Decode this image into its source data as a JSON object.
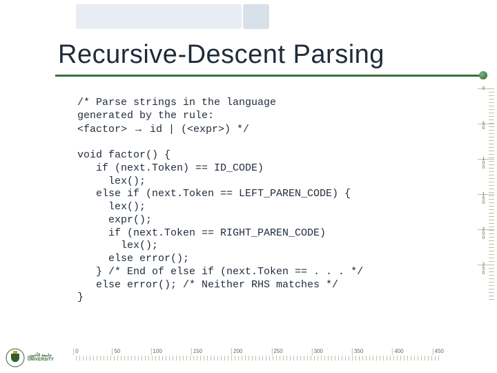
{
  "title": "Recursive-Descent Parsing",
  "code": {
    "comment1_l1": "/* Parse strings in the language",
    "comment1_l2": "generated by the rule:",
    "factor_line_prefix": "<factor> ",
    "factor_line_suffix": " id | (<expr>) */",
    "arrow": "→",
    "l1": "void factor() {",
    "l2": "   if (next.Token) == ID_CODE)",
    "l3": "     lex();",
    "l4": "   else if (next.Token == LEFT_PAREN_CODE) {",
    "l5": "     lex();",
    "l6": "     expr();",
    "l7": "     if (next.Token == RIGHT_PAREN_CODE)",
    "l8": "       lex();",
    "l9": "     else error();",
    "l10": "   } /* End of else if (next.Token == . . . */",
    "l11": "   else error(); /* Neither RHS matches */",
    "l12": "}"
  },
  "vruler": [
    "0",
    "50",
    "100",
    "150",
    "200",
    "250"
  ],
  "hruler": [
    "0",
    "50",
    "100",
    "150",
    "200",
    "250",
    "300",
    "350",
    "400",
    "450"
  ],
  "logo_text_ar": "جامعة الأخوين",
  "logo_text_en": "UNIVERSITY"
}
